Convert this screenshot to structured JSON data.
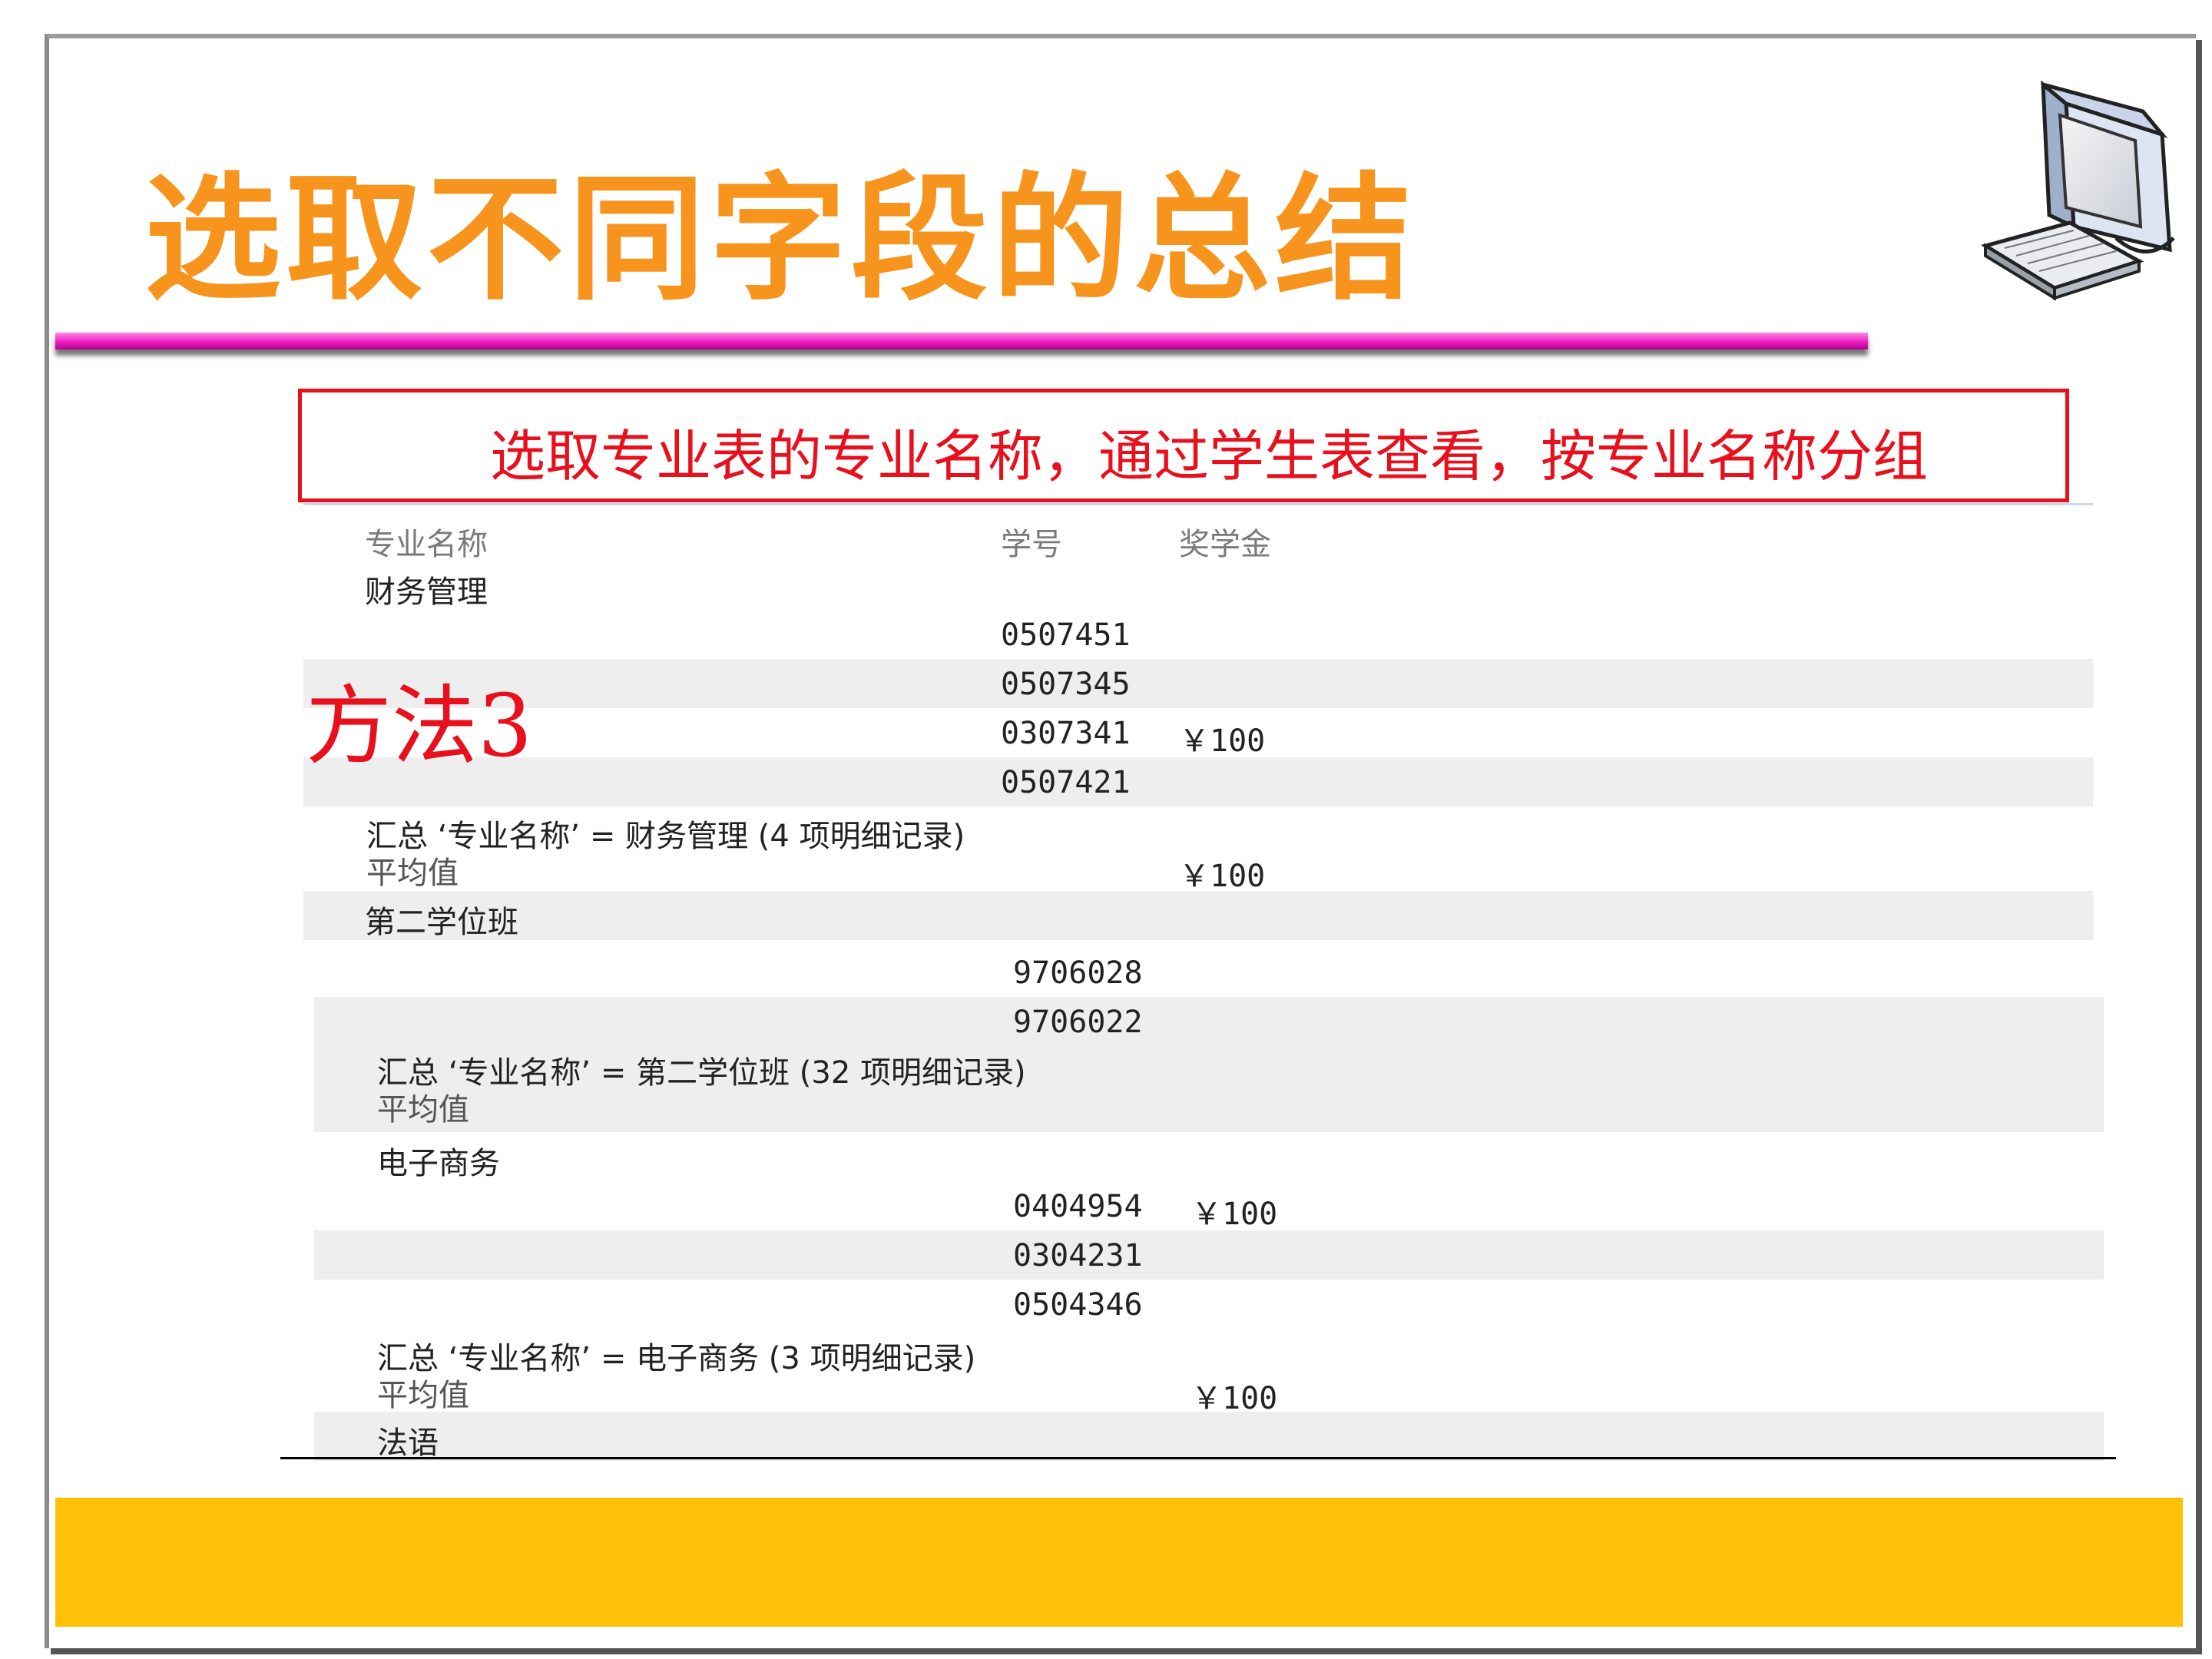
{
  "slide": {
    "title": "选取不同字段的总结",
    "caption": "选取专业表的专业名称，通过学生表查看，按专业名称分组",
    "method_label": "方法3"
  },
  "report": {
    "headers": {
      "major": "专业名称",
      "id": "学号",
      "scholarship": "奖学金"
    },
    "groups": [
      {
        "name": "财务管理",
        "rows": [
          {
            "id": "0507451",
            "scholarship": ""
          },
          {
            "id": "0507345",
            "scholarship": ""
          },
          {
            "id": "0307341",
            "scholarship": "￥100"
          },
          {
            "id": "0507421",
            "scholarship": ""
          }
        ],
        "summary": "汇总 ‘专业名称’ =  财务管理 (4 项明细记录)",
        "avg_label": "平均值",
        "avg_value": "￥100"
      },
      {
        "name": "第二学位班",
        "rows": [
          {
            "id": "9706028",
            "scholarship": ""
          },
          {
            "id": "9706022",
            "scholarship": ""
          }
        ],
        "summary": "汇总 ‘专业名称’ =  第二学位班 (32 项明细记录)",
        "avg_label": "平均值",
        "avg_value": ""
      },
      {
        "name": "电子商务",
        "rows": [
          {
            "id": "0404954",
            "scholarship": "￥100"
          },
          {
            "id": "0304231",
            "scholarship": ""
          },
          {
            "id": "0504346",
            "scholarship": ""
          }
        ],
        "summary": "汇总 ‘专业名称’ =  电子商务 (3 项明细记录)",
        "avg_label": "平均值",
        "avg_value": "￥100"
      },
      {
        "name": "法语",
        "rows": [],
        "summary": "",
        "avg_label": "",
        "avg_value": ""
      }
    ]
  },
  "colors": {
    "title": "#f7941d",
    "accent_red": "#e8101c",
    "rule_pink": "#ee1fc5",
    "footer_yellow": "#ffc107",
    "row_shade": "#eeeeee"
  },
  "icons": {
    "decor": "computer-monitor-keyboard-icon"
  }
}
